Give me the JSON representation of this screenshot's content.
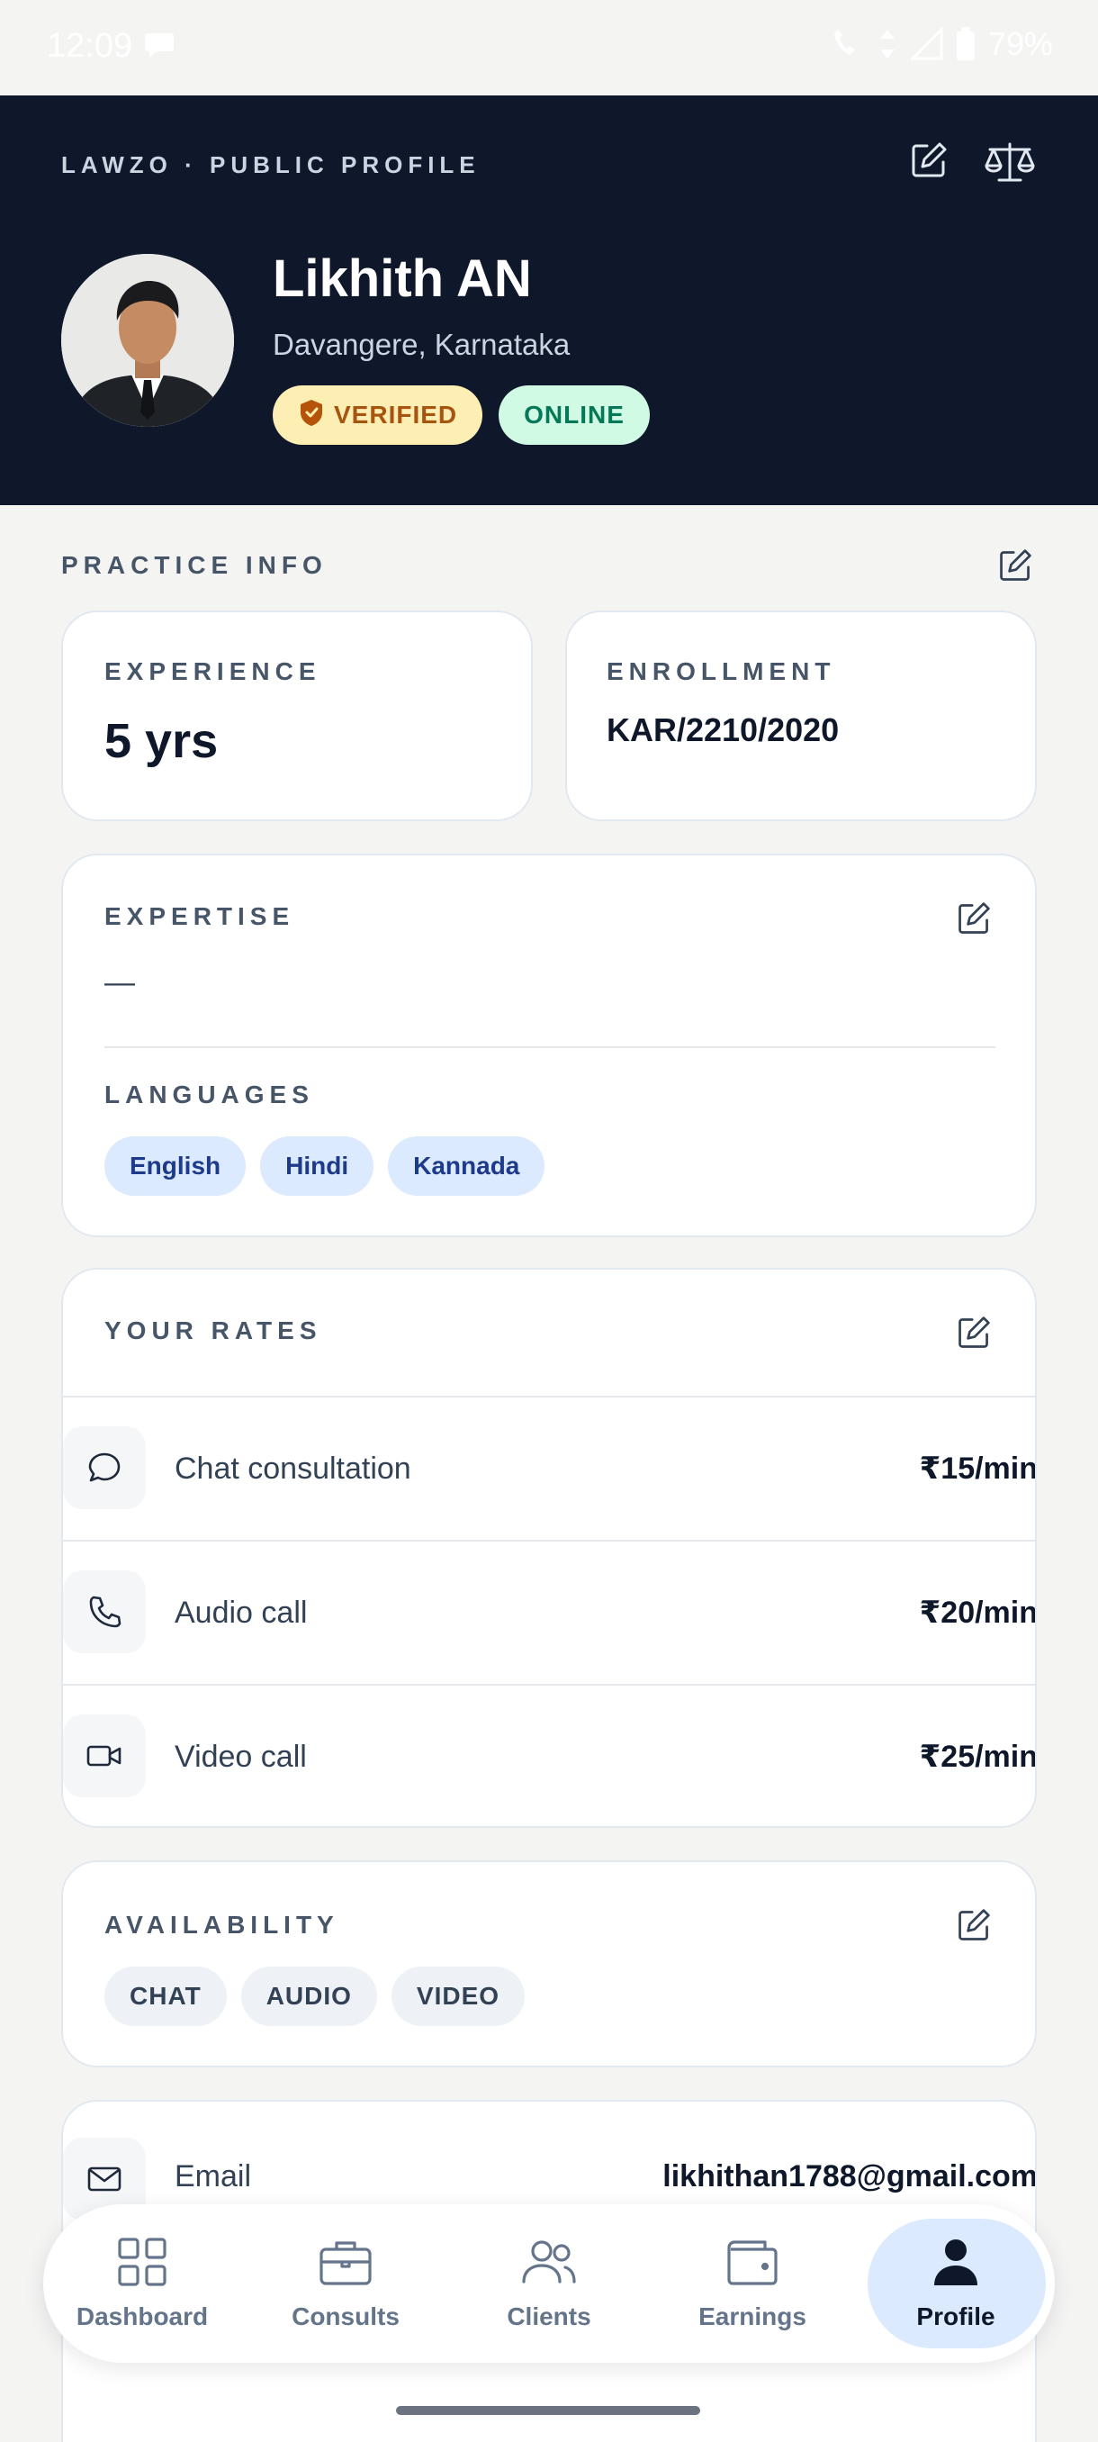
{
  "status_bar": {
    "time": "12:09",
    "battery": "79%"
  },
  "header": {
    "brand": "LAWZO · PUBLIC PROFILE",
    "name": "Likhith AN",
    "location": "Davangere, Karnataka",
    "badge_verified": "VERIFIED",
    "badge_online": "ONLINE",
    "icons": [
      "edit-icon",
      "scales-icon"
    ]
  },
  "practice": {
    "label": "PRACTICE INFO",
    "experience_label": "EXPERIENCE",
    "experience_value": "5 yrs",
    "enrollment_label": "ENROLLMENT",
    "enrollment_value": "KAR/2210/2020"
  },
  "expertise": {
    "label": "EXPERTISE",
    "value": "—",
    "languages_label": "LANGUAGES",
    "languages": [
      "English",
      "Hindi",
      "Kannada"
    ]
  },
  "rates": {
    "label": "YOUR RATES",
    "items": [
      {
        "icon": "chat-bubble-icon",
        "label": "Chat consultation",
        "price": "₹15/min"
      },
      {
        "icon": "phone-icon",
        "label": "Audio call",
        "price": "₹20/min"
      },
      {
        "icon": "video-icon",
        "label": "Video call",
        "price": "₹25/min"
      }
    ]
  },
  "availability": {
    "label": "AVAILABILITY",
    "modes": [
      "CHAT",
      "AUDIO",
      "VIDEO"
    ]
  },
  "contact": {
    "email_label": "Email",
    "email_value": "likhithan1788@gmail.com"
  },
  "bottom_nav": {
    "items": [
      {
        "icon": "grid-icon",
        "label": "Dashboard"
      },
      {
        "icon": "briefcase-icon",
        "label": "Consults"
      },
      {
        "icon": "users-icon",
        "label": "Clients"
      },
      {
        "icon": "wallet-icon",
        "label": "Earnings"
      },
      {
        "icon": "person-icon",
        "label": "Profile"
      }
    ],
    "active": "Profile"
  },
  "colors": {
    "header_bg": "#0f172a",
    "verified_bg": "#fdeeb4",
    "online_bg": "#d1fae5",
    "language_chip_bg": "#dbeafe",
    "active_nav_bg": "#dbeafe"
  }
}
